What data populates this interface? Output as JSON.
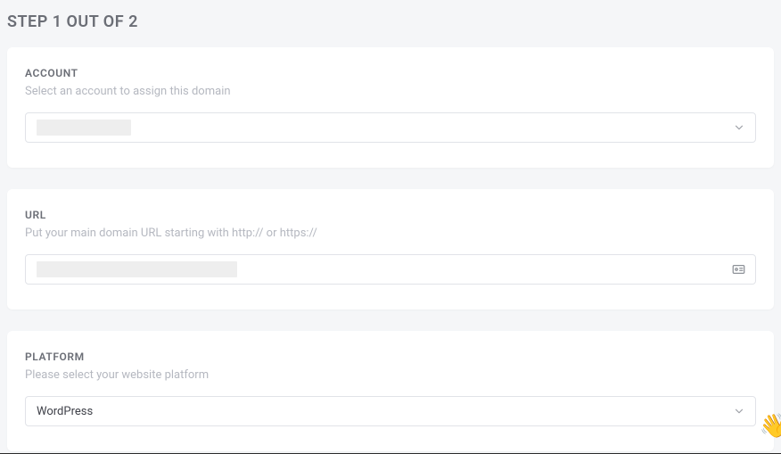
{
  "step": {
    "title": "STEP 1 OUT OF 2"
  },
  "account": {
    "label": "ACCOUNT",
    "sublabel": "Select an account to assign this domain",
    "value": ""
  },
  "url": {
    "label": "URL",
    "sublabel": "Put your main domain URL starting with http:// or https://",
    "value": ""
  },
  "platform": {
    "label": "PLATFORM",
    "sublabel": "Please select your website platform",
    "value": "WordPress"
  }
}
